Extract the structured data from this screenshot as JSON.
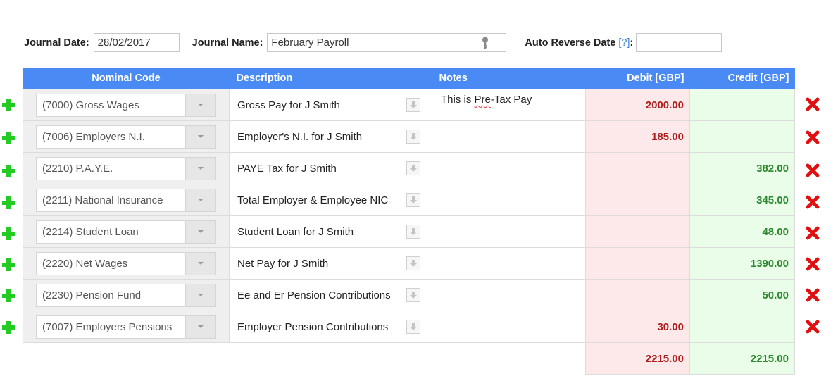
{
  "header": {
    "journal_date_label": "Journal Date:",
    "journal_date_value": "28/02/2017",
    "journal_name_label": "Journal Name:",
    "journal_name_value": "February Payroll",
    "auto_reverse_label": "Auto Reverse Date",
    "auto_reverse_help": "[?]",
    "auto_reverse_colon": ":",
    "auto_reverse_value": ""
  },
  "table": {
    "columns": [
      "Nominal Code",
      "Description",
      "Notes",
      "Debit [GBP]",
      "Credit [GBP]"
    ],
    "rows": [
      {
        "nominal": "(7000) Gross Wages",
        "description": "Gross Pay for J Smith",
        "notes_pre": "This is ",
        "notes_misspelled": "Pre",
        "notes_post": "-Tax Pay",
        "debit": "2000.00",
        "credit": ""
      },
      {
        "nominal": "(7006) Employers N.I.",
        "description": "Employer's N.I. for J Smith",
        "notes_pre": "",
        "notes_misspelled": "",
        "notes_post": "",
        "debit": "185.00",
        "credit": ""
      },
      {
        "nominal": "(2210) P.A.Y.E.",
        "description": "PAYE Tax for J Smith",
        "notes_pre": "",
        "notes_misspelled": "",
        "notes_post": "",
        "debit": "",
        "credit": "382.00"
      },
      {
        "nominal": "(2211) National Insurance",
        "description": "Total Employer & Employee NIC",
        "notes_pre": "",
        "notes_misspelled": "",
        "notes_post": "",
        "debit": "",
        "credit": "345.00"
      },
      {
        "nominal": "(2214) Student Loan",
        "description": "Student Loan for J Smith",
        "notes_pre": "",
        "notes_misspelled": "",
        "notes_post": "",
        "debit": "",
        "credit": "48.00"
      },
      {
        "nominal": "(2220) Net Wages",
        "description": "Net Pay for J Smith",
        "notes_pre": "",
        "notes_misspelled": "",
        "notes_post": "",
        "debit": "",
        "credit": "1390.00"
      },
      {
        "nominal": "(2230) Pension Fund",
        "description": "Ee and Er Pension Contributions",
        "notes_pre": "",
        "notes_misspelled": "",
        "notes_post": "",
        "debit": "",
        "credit": "50.00"
      },
      {
        "nominal": "(7007) Employers Pensions",
        "description": "Employer Pension Contributions",
        "notes_pre": "",
        "notes_misspelled": "",
        "notes_post": "",
        "debit": "30.00",
        "credit": ""
      }
    ],
    "totals": {
      "debit": "2215.00",
      "credit": "2215.00"
    }
  },
  "icons": {
    "add_row": "plus-icon",
    "delete_row": "cross-icon",
    "copy_down": "arrow-down-icon",
    "dropdown": "chevron-down-icon",
    "key": "key-icon"
  },
  "colors": {
    "header_bg": "#4a8af4",
    "debit_bg": "#fde9e9",
    "credit_bg": "#e9fde9",
    "debit_text": "#b01c1c",
    "credit_text": "#2c8a2c",
    "add_icon": "#22cc22",
    "delete_icon": "#e01010"
  }
}
